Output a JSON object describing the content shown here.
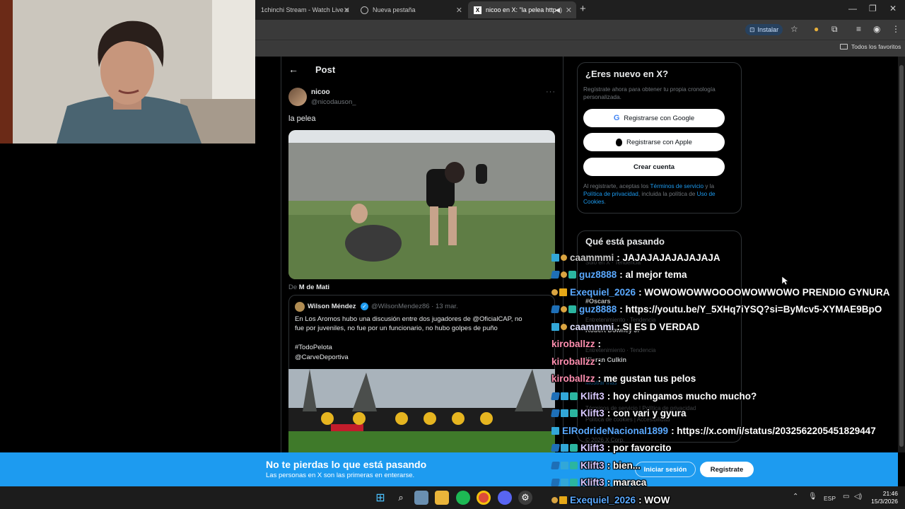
{
  "browser": {
    "tabs": [
      {
        "label": "1chinchi Stream - Watch Live o",
        "active": false
      },
      {
        "label": "Nueva pestaña",
        "active": false
      },
      {
        "label": "nicoo en X: \"la pelea https:/",
        "active": true
      }
    ],
    "new_tab_icon": "+",
    "install_label": "Instalar",
    "bookmarks_folder": "Todos los favoritos"
  },
  "post": {
    "header_title": "Post",
    "author_name": "nicoo",
    "author_handle": "@nicodauson_",
    "text": "la pelea",
    "via_prefix": "De",
    "via_name": "M de Mati"
  },
  "quote": {
    "name": "Wilson Méndez",
    "handle_date": "@WilsonMendez86 · 13 mar.",
    "lines": [
      "En Los Aromos hubo una discusión entre dos jugadores de @OficialCAP, no",
      "fue por juveniles, no fue por un funcionario, no hubo golpes de puño",
      "",
      "#TodoPelota",
      "@CarveDeportiva"
    ]
  },
  "signup": {
    "title": "¿Eres nuevo en X?",
    "subtitle": "Regístrate ahora para obtener tu propia cronología personalizada.",
    "google_button": "Registrarse con Google",
    "apple_button": "Registrarse con Apple",
    "create_button": "Crear cuenta",
    "legal_prefix": "Al registrarte, aceptas los",
    "legal_terms": "Términos de servicio",
    "legal_and": "y la",
    "legal_privacy": "Política de privacidad",
    "legal_mid": ", incluida la política de",
    "legal_cookies": "Uso de Cookies",
    "legal_end": "."
  },
  "trends": {
    "title": "Qué está pasando",
    "faint": [
      "Solo en X · Tendencia",
      "#Oscars",
      "Entretenimiento · Tendencia",
      "Robert Downey Jr",
      "Entretenimiento · Tendencia",
      "Kieran Culkin",
      "Mostrar más",
      "Términos de servicio | Política de privacidad",
      "Política de cookies | Accesibilidad",
      "© 2026 X Corp."
    ]
  },
  "banner": {
    "title": "No te pierdas lo que está pasando",
    "subtitle": "Las personas en X son las primeras en enterarse.",
    "login": "Iniciar sesión",
    "register": "Regístrate"
  },
  "taskbar": {
    "lang": "ESP",
    "time": "21:46",
    "date": "15/3/2026"
  },
  "chat": [
    {
      "badges": [
        "cube",
        "bits"
      ],
      "author": "caammmi",
      "color": "#c9c9c9",
      "text": ": JAJAJAJAJAJAJAJA"
    },
    {
      "badges": [
        "prime",
        "bits",
        "sub"
      ],
      "author": "guz8888",
      "color": "#5aa9ff",
      "text": ": al mejor tema"
    },
    {
      "badges": [
        "bits",
        "vip"
      ],
      "author": "Exequiel_2026",
      "color": "#5aa9ff",
      "text": ": WOWOWOWWOOOOWOWWOWO PRENDIO GYNURA"
    },
    {
      "badges": [
        "prime",
        "bits",
        "sub"
      ],
      "author": "guz8888",
      "color": "#5aa9ff",
      "text": ": https://youtu.be/Y_5XHq7iYSQ?si=ByMcv5-XYMAE9BpO"
    },
    {
      "badges": [
        "cube",
        "bits"
      ],
      "author": "caammmi",
      "color": "#e0e0ff",
      "text": ": SI ES D VERDAD"
    },
    {
      "badges": [],
      "author": "kiroballzz",
      "color": "#ff8fb0",
      "text": ":"
    },
    {
      "badges": [],
      "author": "kiroballzz",
      "color": "#ff8fb0",
      "text": ":"
    },
    {
      "badges": [],
      "author": "kiroballzz",
      "color": "#ff8fb0",
      "text": ": me gustan tus pelos"
    },
    {
      "badges": [
        "prime",
        "cube",
        "sub"
      ],
      "author": "Klift3",
      "color": "#d9c9ff",
      "text": ": hoy chingamos mucho mucho?"
    },
    {
      "badges": [
        "prime",
        "cube",
        "sub"
      ],
      "author": "Klift3",
      "color": "#d9c9ff",
      "text": ": con vari y gyura"
    },
    {
      "badges": [
        "cube"
      ],
      "author": "ElRodrideNacional1899",
      "color": "#5aa9ff",
      "text": ": https://x.com/i/status/2032562205451829447"
    },
    {
      "badges": [
        "prime",
        "cube",
        "sub"
      ],
      "author": "Klift3",
      "color": "#d9c9ff",
      "text": ": por favorcito"
    },
    {
      "badges": [
        "prime",
        "cube",
        "sub"
      ],
      "author": "Klift3",
      "color": "#d9c9ff",
      "text": ": bien..."
    },
    {
      "badges": [
        "prime",
        "cube",
        "sub"
      ],
      "author": "Klift3",
      "color": "#d9c9ff",
      "text": ": maraca"
    },
    {
      "badges": [
        "bits",
        "vip"
      ],
      "author": "Exequiel_2026",
      "color": "#5aa9ff",
      "text": ": WOW"
    }
  ]
}
